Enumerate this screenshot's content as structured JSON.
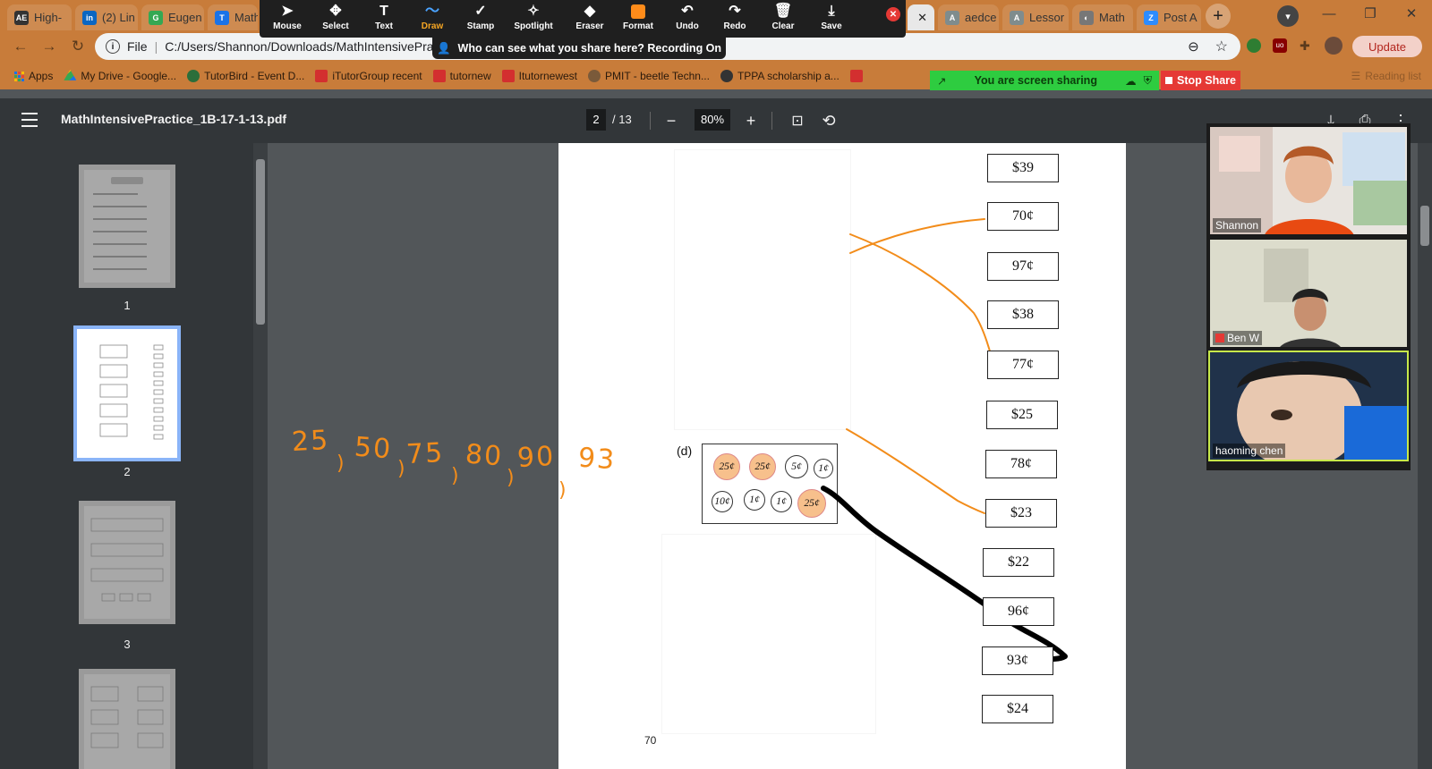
{
  "browser": {
    "tabs": [
      {
        "label": "High-",
        "color": "#333333",
        "fav": "AE"
      },
      {
        "label": "(2) Lin",
        "color": "#0a66c2",
        "fav": "in"
      },
      {
        "label": "Eugen",
        "color": "#34a853",
        "fav": "G"
      },
      {
        "label": "Math",
        "color": "#1a73e8",
        "fav": "T"
      },
      {
        "label": "aedce",
        "color": "#7f8c8d",
        "fav": "A"
      },
      {
        "label": "Lessor",
        "color": "#7f8c8d",
        "fav": "A"
      },
      {
        "label": "Math",
        "color": "#777777",
        "fav": "◐"
      },
      {
        "label": "Post A",
        "color": "#2d8cff",
        "fav": "Z"
      }
    ],
    "address": {
      "scheme": "File",
      "url": "C:/Users/Shannon/Downloads/MathIntensivePrac"
    },
    "update_label": "Update",
    "reading_list": "Reading list",
    "bookmarks": [
      {
        "label": "Apps",
        "kind": "apps"
      },
      {
        "label": "My Drive - Google...",
        "kind": "drive"
      },
      {
        "label": "TutorBird - Event D...",
        "kind": "tutorbird"
      },
      {
        "label": "iTutorGroup recent",
        "kind": "redi"
      },
      {
        "label": "tutornew",
        "kind": "redi"
      },
      {
        "label": "Itutornewest",
        "kind": "redi"
      },
      {
        "label": "PMIT - beetle Techn...",
        "kind": "pmit"
      },
      {
        "label": "TPPA scholarship a...",
        "kind": "tppa"
      }
    ]
  },
  "zoom": {
    "tools": [
      {
        "label": "Mouse",
        "glyph": "➤",
        "active": false
      },
      {
        "label": "Select",
        "glyph": "✥",
        "active": false
      },
      {
        "label": "Text",
        "glyph": "T",
        "active": false
      },
      {
        "label": "Draw",
        "glyph": "〜",
        "active": true
      },
      {
        "label": "Stamp",
        "glyph": "✓",
        "active": false
      },
      {
        "label": "Spotlight",
        "glyph": "✧",
        "active": false
      },
      {
        "label": "Eraser",
        "glyph": "◆",
        "active": false
      },
      {
        "label": "Format",
        "glyph": "",
        "active": false
      },
      {
        "label": "Undo",
        "glyph": "↶",
        "active": false
      },
      {
        "label": "Redo",
        "glyph": "↷",
        "active": false
      },
      {
        "label": "Clear",
        "glyph": "🗑",
        "active": false
      },
      {
        "label": "Save",
        "glyph": "⤓",
        "active": false
      }
    ],
    "recording_text": "Who can see what you share here? Recording On",
    "sharing_text": "You are screen sharing",
    "stop_share_label": "Stop Share",
    "format_color": "#ff8c1a"
  },
  "pdf": {
    "title": "MathIntensivePractice_1B-17-1-13.pdf",
    "current_page": "2",
    "total_pages": "/ 13",
    "zoom": "80%",
    "thumbnails": [
      {
        "num": "1",
        "selected": false
      },
      {
        "num": "2",
        "selected": true
      },
      {
        "num": "3",
        "selected": false
      }
    ],
    "question_label": "(d)",
    "page_number": "70",
    "amounts": [
      "$39",
      "70¢",
      "97¢",
      "$38",
      "77¢",
      "$25",
      "78¢",
      "$23",
      "$22",
      "96¢",
      "93¢",
      "$24"
    ],
    "coins_row1": [
      {
        "label": "25¢",
        "highlight": true
      },
      {
        "label": "25¢",
        "highlight": true
      },
      {
        "label": "5¢",
        "highlight": false
      },
      {
        "label": "1¢",
        "highlight": false
      }
    ],
    "coins_row2": [
      {
        "label": "10¢",
        "highlight": false
      },
      {
        "label": "1¢",
        "highlight": false
      },
      {
        "label": "1¢",
        "highlight": false
      },
      {
        "label": "25¢",
        "highlight": true
      }
    ],
    "handwriting": [
      "25",
      "50",
      "75",
      "80",
      "90",
      "93"
    ],
    "annotation_colors": {
      "orange": "#f28c1a",
      "black": "#000000"
    }
  },
  "participants": [
    {
      "name": "Shannon",
      "muted": false,
      "speaking": false
    },
    {
      "name": "Ben W",
      "muted": true,
      "speaking": false
    },
    {
      "name": "haoming   chen",
      "muted": false,
      "speaking": true
    }
  ]
}
